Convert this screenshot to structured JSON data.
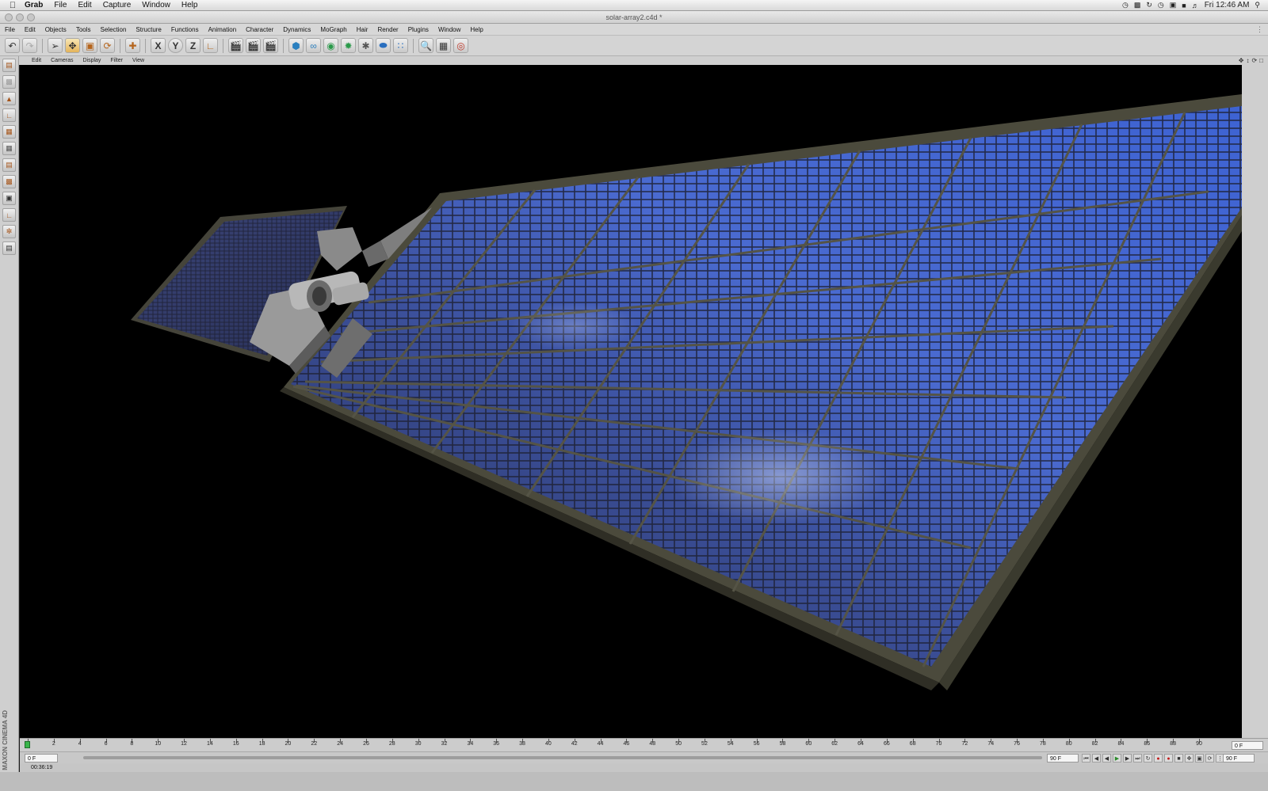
{
  "mac_menu": {
    "apple": "",
    "items": [
      "Grab",
      "File",
      "Edit",
      "Capture",
      "Window",
      "Help"
    ],
    "clock": "Fri 12:46 AM"
  },
  "window": {
    "title": "solar-array2.c4d *"
  },
  "app_menu": [
    "File",
    "Edit",
    "Objects",
    "Tools",
    "Selection",
    "Structure",
    "Functions",
    "Animation",
    "Character",
    "Dynamics",
    "MoGraph",
    "Hair",
    "Render",
    "Plugins",
    "Window",
    "Help"
  ],
  "toolbar": {
    "axis_x": "X",
    "axis_y": "Y",
    "axis_z": "Z"
  },
  "viewport_menu": [
    "Edit",
    "Cameras",
    "Display",
    "Filter",
    "View"
  ],
  "brand": "MAXON CINEMA 4D",
  "timeline": {
    "ticks": [
      "0",
      "2",
      "4",
      "6",
      "8",
      "10",
      "12",
      "14",
      "16",
      "18",
      "20",
      "22",
      "24",
      "26",
      "28",
      "30",
      "32",
      "34",
      "36",
      "38",
      "40",
      "42",
      "44",
      "46",
      "48",
      "50",
      "52",
      "54",
      "56",
      "58",
      "60",
      "62",
      "64",
      "66",
      "68",
      "70",
      "72",
      "74",
      "76",
      "78",
      "80",
      "82",
      "84",
      "86",
      "88",
      "90"
    ],
    "current_frame": "0 F"
  },
  "transport": {
    "start_field": "0 F",
    "end_field": "90 F",
    "max_field": "90 F"
  },
  "status": {
    "time": "00:36:19"
  },
  "colors": {
    "viewport_bg": "#000000",
    "panel_blue": "#3a5fc7",
    "frame": "#4b4a3c",
    "ui_gray": "#d4d4d4"
  }
}
